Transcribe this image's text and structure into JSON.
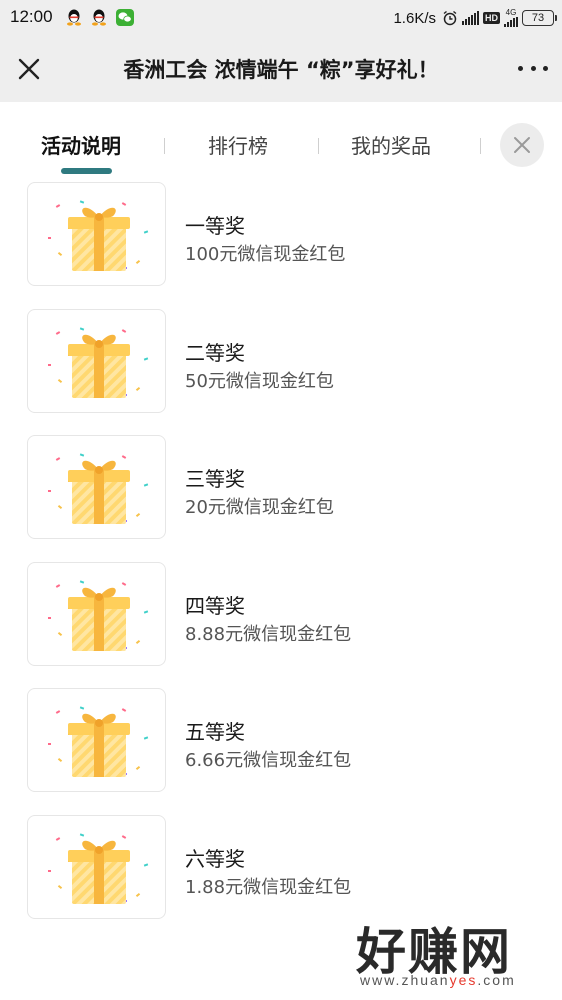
{
  "status_bar": {
    "time": "12:00",
    "net_speed": "1.6K/s",
    "hd": "HD",
    "network": "4G",
    "battery": "73",
    "icons": [
      "qq-icon",
      "qq-icon",
      "wechat-icon",
      "alarm-icon",
      "signal-icon",
      "hd-icon",
      "signal-4g-icon",
      "battery-icon"
    ]
  },
  "title_bar": {
    "title": "香洲工会 浓情端午 “粽”享好礼！",
    "close_icon": "close-icon",
    "more_icon": "more-icon"
  },
  "tabs": {
    "items": [
      {
        "label": "活动说明",
        "active": true
      },
      {
        "label": "排行榜",
        "active": false
      },
      {
        "label": "我的奖品",
        "active": false
      }
    ],
    "accent_color": "#2f7a80",
    "close_icon": "close-icon"
  },
  "prizes": [
    {
      "name": "一等奖",
      "desc": "100元微信现金红包",
      "icon": "gift-box-icon"
    },
    {
      "name": "二等奖",
      "desc": "50元微信现金红包",
      "icon": "gift-box-icon"
    },
    {
      "name": "三等奖",
      "desc": "20元微信现金红包",
      "icon": "gift-box-icon"
    },
    {
      "name": "四等奖",
      "desc": "8.88元微信现金红包",
      "icon": "gift-box-icon"
    },
    {
      "name": "五等奖",
      "desc": "6.66元微信现金红包",
      "icon": "gift-box-icon"
    },
    {
      "name": "六等奖",
      "desc": "1.88元微信现金红包",
      "icon": "gift-box-icon"
    }
  ],
  "watermark": {
    "logo": "好赚网",
    "url_prefix": "www.zhuan",
    "url_highlight": "yes",
    "url_suffix": ".com"
  }
}
